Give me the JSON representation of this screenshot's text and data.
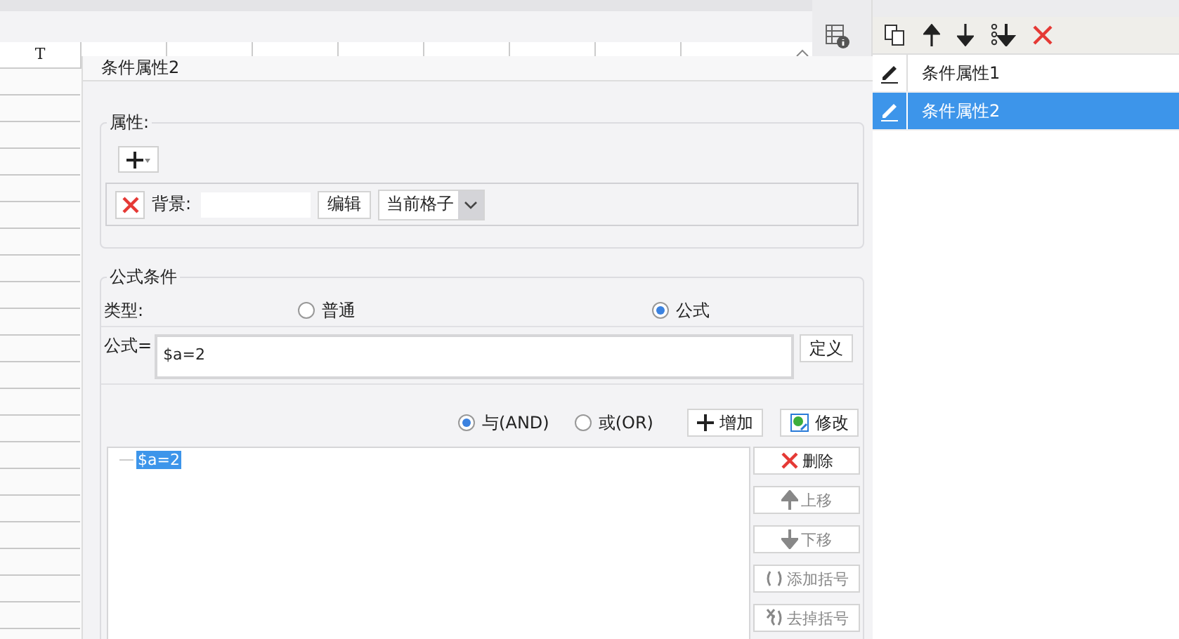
{
  "spreadsheet": {
    "column_header": "T"
  },
  "condition_panel": {
    "items": [
      {
        "label": "条件属性1",
        "selected": false
      },
      {
        "label": "条件属性2",
        "selected": true
      }
    ]
  },
  "dialog": {
    "title": "条件属性2",
    "attributes": {
      "legend": "属性:",
      "background_label": "背景:",
      "edit_button": "编辑",
      "scope": "当前格子"
    },
    "formula_condition": {
      "legend": "公式条件",
      "type_label": "类型:",
      "types": [
        {
          "label": "普通",
          "selected": false
        },
        {
          "label": "公式",
          "selected": true
        }
      ],
      "formula_label": "公式=",
      "formula": "$a=2",
      "define_button": "定义",
      "logic": [
        {
          "label": "与(AND)",
          "selected": true
        },
        {
          "label": "或(OR)",
          "selected": false
        }
      ],
      "add_button": "增加",
      "modify_button": "修改",
      "conditions": [
        {
          "text": "$a=2",
          "selected": true
        }
      ],
      "actions": [
        {
          "kind": "delete",
          "label": "删除",
          "disabled": false
        },
        {
          "kind": "up",
          "label": "上移",
          "disabled": true
        },
        {
          "kind": "down",
          "label": "下移",
          "disabled": true
        },
        {
          "kind": "add-paren",
          "label": "添加括号",
          "disabled": true
        },
        {
          "kind": "remove-paren",
          "label": "去掉括号",
          "disabled": true
        }
      ]
    }
  }
}
